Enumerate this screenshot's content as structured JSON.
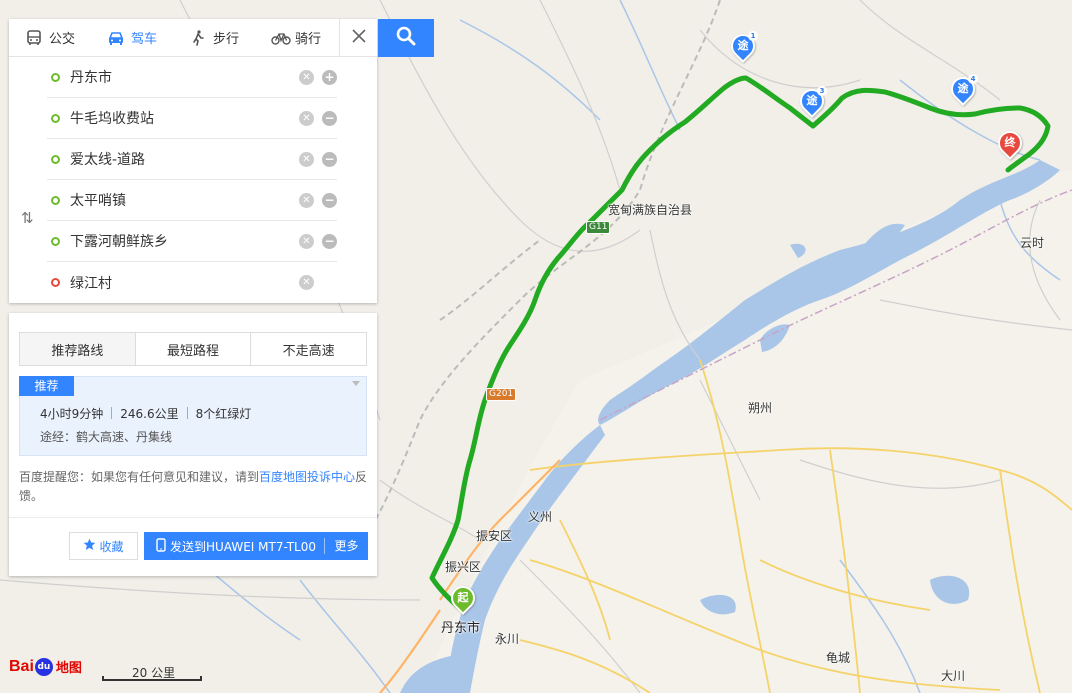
{
  "tabs": [
    {
      "label": "公交",
      "icon": "bus-icon",
      "active": false
    },
    {
      "label": "驾车",
      "icon": "car-icon",
      "active": true
    },
    {
      "label": "步行",
      "icon": "walk-icon",
      "active": false
    },
    {
      "label": "骑行",
      "icon": "bike-icon",
      "active": false
    }
  ],
  "waypoints": [
    {
      "name": "丹东市",
      "action": "+"
    },
    {
      "name": "牛毛坞收费站",
      "action": "−"
    },
    {
      "name": "爱太线-道路",
      "action": "−"
    },
    {
      "name": "太平哨镇",
      "action": "−"
    },
    {
      "name": "下露河朝鲜族乡",
      "action": "−"
    },
    {
      "name": "绿江村",
      "action": ""
    }
  ],
  "route_tabs": [
    "推荐路线",
    "最短路程",
    "不走高速"
  ],
  "route": {
    "badge": "推荐",
    "time": "4小时9分钟",
    "distance": "246.6公里",
    "lights": "8个红绿灯",
    "via": "途经：鹤大高速、丹集线"
  },
  "tip": {
    "prefix": "百度提醒您：如果您有任何意见和建议，请到",
    "link": "百度地图投诉中心",
    "suffix": "反馈。"
  },
  "actions": {
    "favorite": "收藏",
    "send": "发送到HUAWEI MT7-TL00",
    "more": "更多"
  },
  "map": {
    "labels": {
      "kuandian": "宽甸满族自治县",
      "yunshi": "云时",
      "shuozhou": "朔州",
      "yizhou": "义州",
      "zhenan": "振安区",
      "zhenxing": "振兴区",
      "dandong": "丹东市",
      "yongchuan": "永川",
      "guicheng": "龟城",
      "dachuan": "大川"
    },
    "shields": {
      "g11": "G11",
      "g201": "G201"
    },
    "markers": {
      "start": "起",
      "end": "终",
      "via": "途",
      "via_numbers": [
        "1",
        "3",
        "4"
      ]
    }
  },
  "brand": {
    "bai": "Bai",
    "du": "du",
    "cn": "地图"
  },
  "scale": "20 公里",
  "colors": {
    "accent": "#3385ff",
    "route": "#22aa22",
    "water": "#a9c6e8",
    "end": "#e8493e",
    "start": "#6cbb2b"
  }
}
